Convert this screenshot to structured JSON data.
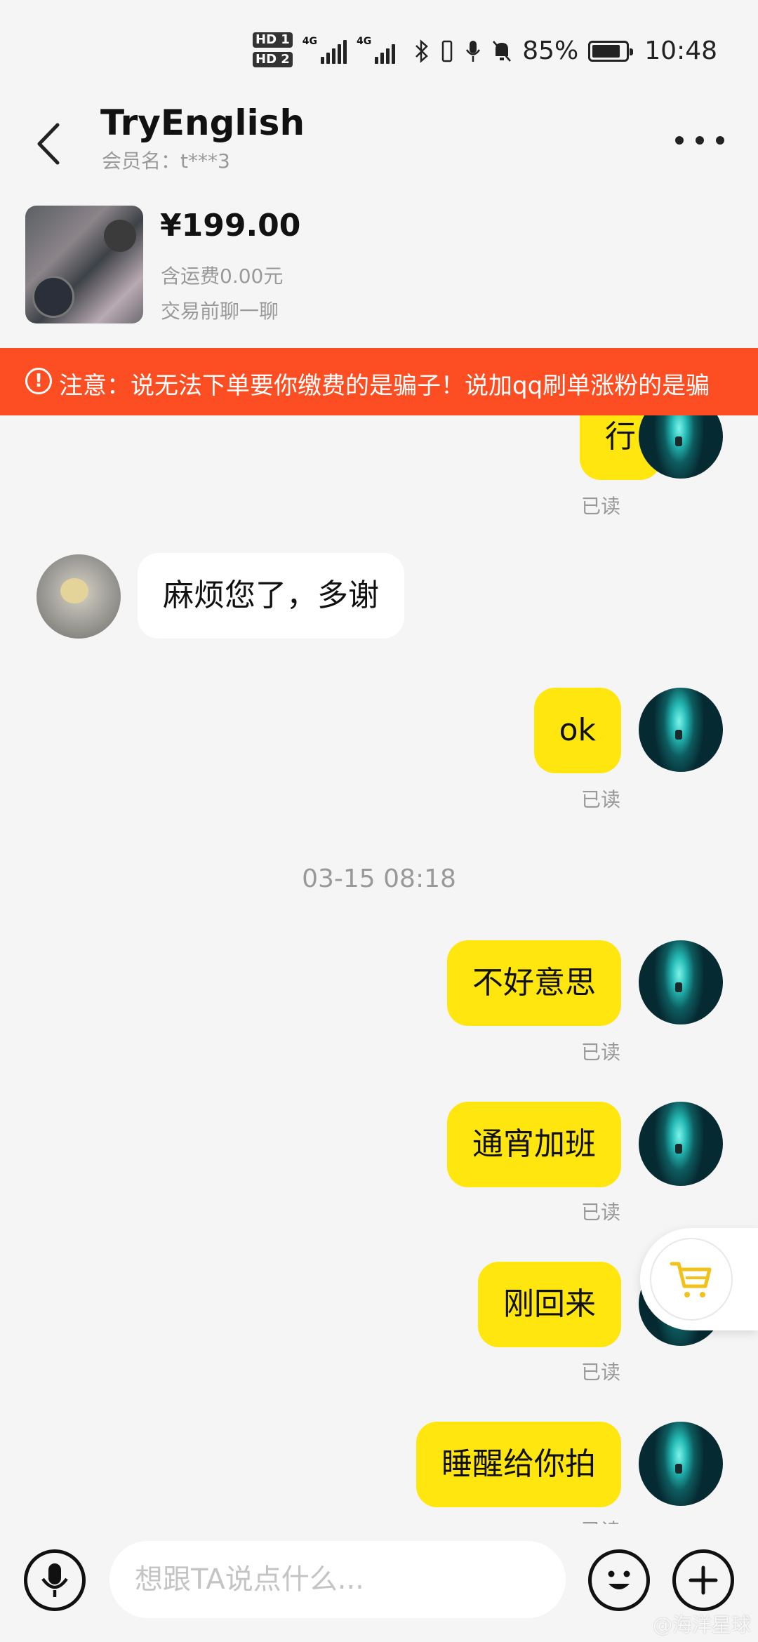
{
  "status_bar": {
    "hd1": "HD 1",
    "hd2": "HD 2",
    "net1": "4G",
    "net2": "4G",
    "battery_percent": "85%",
    "battery_level": 0.85,
    "time": "10:48",
    "icons": [
      "bluetooth-icon",
      "vibrate-icon",
      "mic-icon",
      "mute-icon",
      "battery-icon"
    ]
  },
  "header": {
    "title": "TryEnglish",
    "member_label": "会员名：t***3"
  },
  "product": {
    "price": "¥199.00",
    "shipping": "含运费0.00元",
    "chat_hint": "交易前聊一聊"
  },
  "warning": {
    "text": "注意：说无法下单要你缴费的是骗子！说加qq刷单涨粉的是骗"
  },
  "messages": [
    {
      "from": "me",
      "text": "行",
      "status": "已读"
    },
    {
      "from": "them",
      "text": "麻烦您了，多谢"
    },
    {
      "from": "me",
      "text": "ok",
      "status": "已读"
    },
    {
      "type": "time",
      "text": "03-15 08:18"
    },
    {
      "from": "me",
      "text": "不好意思",
      "status": "已读"
    },
    {
      "from": "me",
      "text": "通宵加班",
      "status": "已读"
    },
    {
      "from": "me",
      "text": "刚回来",
      "status": "已读"
    },
    {
      "from": "me",
      "text": "睡醒给你拍",
      "status": "已读"
    }
  ],
  "input": {
    "placeholder": "想跟TA说点什么..."
  },
  "colors": {
    "accent_yellow": "#ffe60f",
    "warning_red": "#fc4e22",
    "background": "#f5f5f5"
  },
  "watermark": "@海洋星球"
}
